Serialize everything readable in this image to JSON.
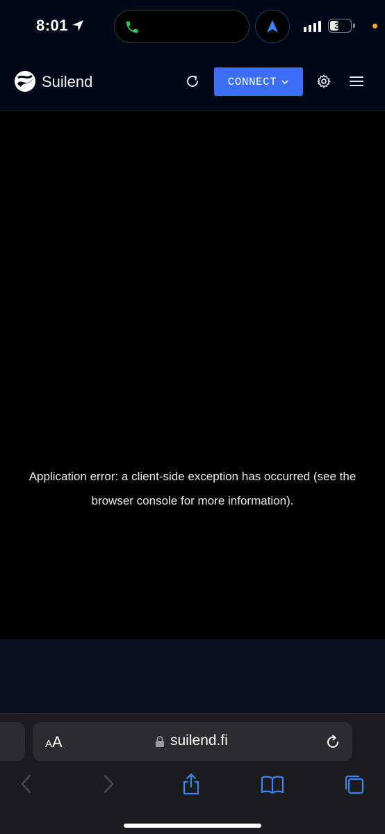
{
  "status_bar": {
    "time": "8:01",
    "battery": "39",
    "icons": [
      "location-arrow-icon",
      "phone-icon",
      "navigation-icon",
      "signal-icon",
      "battery-icon"
    ]
  },
  "header": {
    "brand": "Suilend",
    "connect_label": "CONNECT",
    "icons": [
      "suilend-logo",
      "refresh-icon",
      "chevron-down-icon",
      "gear-icon",
      "menu-icon"
    ]
  },
  "main": {
    "error_message": "Application error: a client-side exception has occurred (see the browser console for more information)."
  },
  "browser": {
    "text_size_label_small": "A",
    "text_size_label_large": "A",
    "url": "suilend.fi",
    "icons": [
      "lock-icon",
      "reload-icon",
      "back-icon",
      "forward-icon",
      "share-icon",
      "bookmarks-icon",
      "tabs-icon"
    ]
  },
  "colors": {
    "header_bg": "#020817",
    "connect_button": "#3b6df5",
    "content_bg": "#000000",
    "browser_bar": "#1c1c1e",
    "accent_blue": "#3b82f6"
  }
}
